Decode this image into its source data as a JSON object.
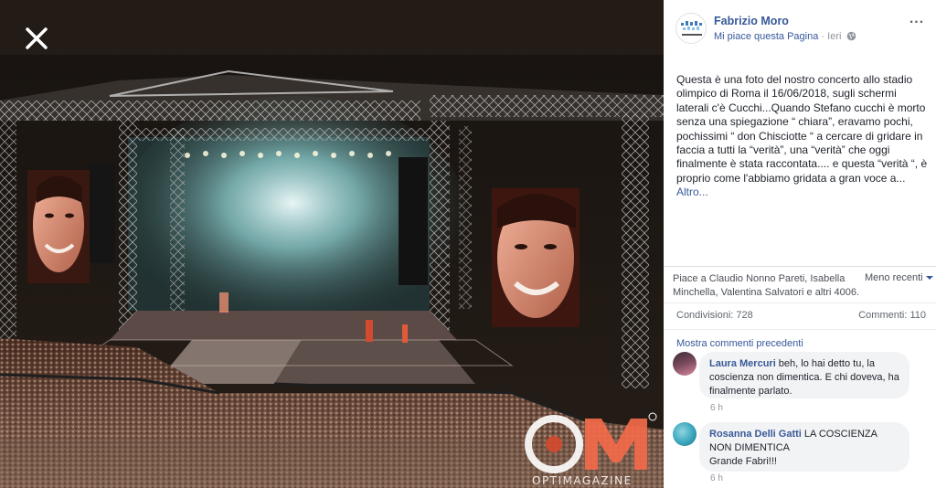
{
  "viewer": {
    "close_label": "close-icon",
    "watermark_text": "OPTIMAGAZINE"
  },
  "post": {
    "page_name": "Fabrizio Moro",
    "like_page": "Mi piace questa Pagina",
    "separator": " · ",
    "time": "Ieri",
    "more_icon": "...",
    "text": "Questa è una foto del nostro concerto allo stadio olimpico di Roma il 16/06/2018, sugli schermi laterali c'è Cucchi...Quando Stefano cucchi è morto senza una spiegazione “ chiara”, eravamo pochi, pochissimi “ don Chisciotte “ a cercare di gridare in faccia a tutti la “verità”, una “verità” che oggi finalmente è stata raccontata.... e questa “verità “, è proprio come l'abbiamo gridata a gran voce a...",
    "more_link": "Altro..."
  },
  "engagement": {
    "likes_text": "Piace a Claudio Nonno Pareti, Isabella Minchella, Valentina Salvatori e altri 4006.",
    "sort_label": "Meno recenti",
    "shares": "Condivisioni: 728",
    "comments": "Commenti: 110"
  },
  "comments": {
    "show_previous": "Mostra commenti precedenti",
    "items": [
      {
        "author": "Laura Mercuri",
        "text": " beh, lo hai detto tu, la coscienza non dimentica. E chi doveva, ha finalmente parlato.",
        "time": "6 h"
      },
      {
        "author": "Rosanna Delli Gatti",
        "text": " LA COSCIENZA NON DIMENTICA\nGrande Fabri!!!",
        "time": "6 h"
      }
    ]
  },
  "colors": {
    "link": "#365899",
    "watermark_orange": "#f26a4a",
    "panel_bg": "#ffffff"
  }
}
